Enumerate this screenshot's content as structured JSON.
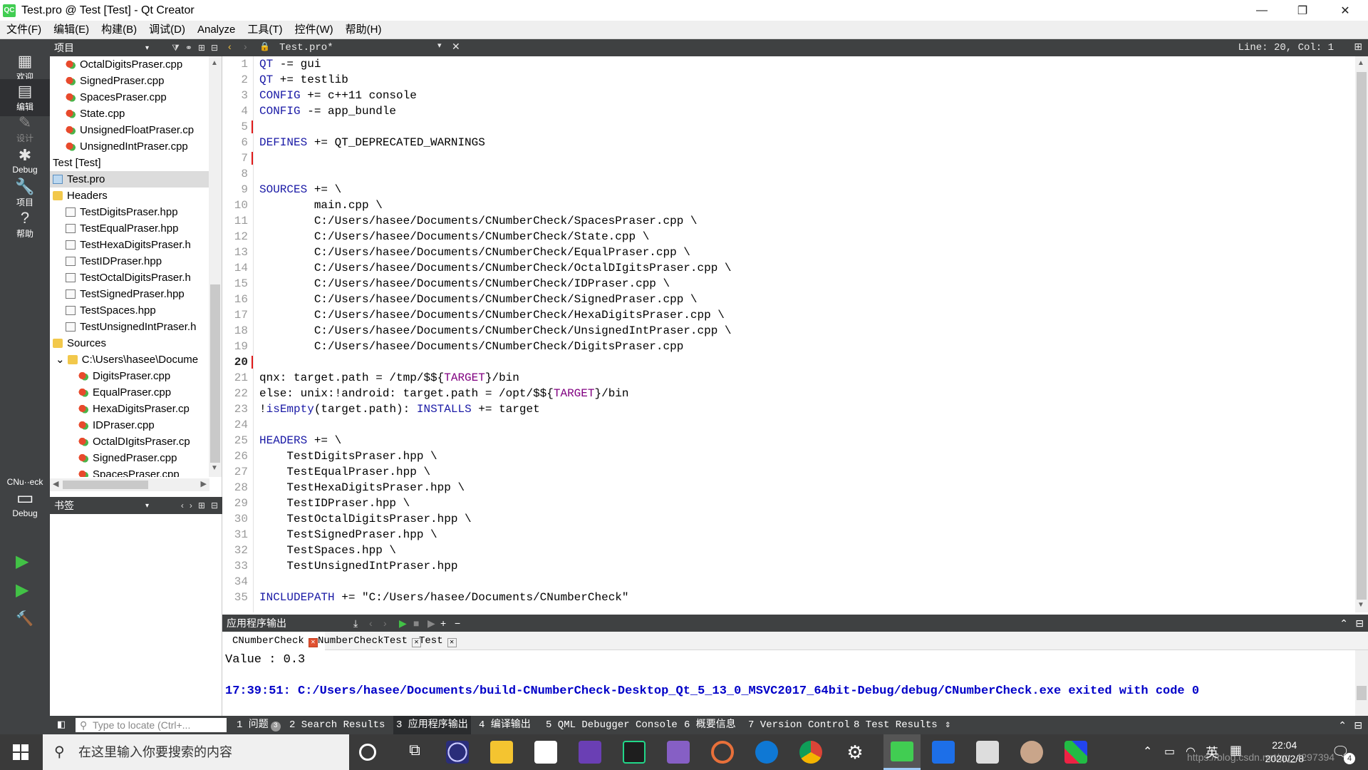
{
  "window": {
    "title": "Test.pro @ Test [Test] - Qt Creator",
    "app_icon": "QC"
  },
  "menu": [
    "文件(F)",
    "编辑(E)",
    "构建(B)",
    "调试(D)",
    "Analyze",
    "工具(T)",
    "控件(W)",
    "帮助(H)"
  ],
  "modes": [
    {
      "label": "欢迎",
      "icon": "grid-icon"
    },
    {
      "label": "编辑",
      "icon": "edit-icon",
      "active": true
    },
    {
      "label": "设计",
      "icon": "design-icon",
      "dim": true
    },
    {
      "label": "Debug",
      "icon": "bug-icon"
    },
    {
      "label": "项目",
      "icon": "wrench-icon"
    },
    {
      "label": "帮助",
      "icon": "help-icon"
    }
  ],
  "kit": {
    "project": "CNu··eck",
    "config": "Debug"
  },
  "project_panel": {
    "title": "项目",
    "tree": [
      {
        "indent": 1,
        "type": "cpp",
        "label": "OctalDigitsPraser.cpp"
      },
      {
        "indent": 1,
        "type": "cpp",
        "label": "SignedPraser.cpp"
      },
      {
        "indent": 1,
        "type": "cpp",
        "label": "SpacesPraser.cpp"
      },
      {
        "indent": 1,
        "type": "cpp",
        "label": "State.cpp"
      },
      {
        "indent": 1,
        "type": "cpp",
        "label": "UnsignedFloatPraser.cp"
      },
      {
        "indent": 1,
        "type": "cpp",
        "label": "UnsignedIntPraser.cpp"
      },
      {
        "indent": 0,
        "type": "none",
        "label": "Test [Test]"
      },
      {
        "indent": 0,
        "type": "pro",
        "label": "Test.pro",
        "selected": true
      },
      {
        "indent": 0,
        "type": "fold",
        "label": "Headers"
      },
      {
        "indent": 1,
        "type": "hpp",
        "label": "TestDigitsPraser.hpp"
      },
      {
        "indent": 1,
        "type": "hpp",
        "label": "TestEqualPraser.hpp"
      },
      {
        "indent": 1,
        "type": "hpp",
        "label": "TestHexaDigitsPraser.h"
      },
      {
        "indent": 1,
        "type": "hpp",
        "label": "TestIDPraser.hpp"
      },
      {
        "indent": 1,
        "type": "hpp",
        "label": "TestOctalDigitsPraser.h"
      },
      {
        "indent": 1,
        "type": "hpp",
        "label": "TestSignedPraser.hpp"
      },
      {
        "indent": 1,
        "type": "hpp",
        "label": "TestSpaces.hpp"
      },
      {
        "indent": 1,
        "type": "hpp",
        "label": "TestUnsignedIntPraser.h"
      },
      {
        "indent": 0,
        "type": "fold",
        "label": "Sources"
      },
      {
        "indent": 1,
        "type": "fold",
        "label": "C:\\Users\\hasee\\Docume",
        "expanded": true
      },
      {
        "indent": 2,
        "type": "cpp",
        "label": "DigitsPraser.cpp"
      },
      {
        "indent": 2,
        "type": "cpp",
        "label": "EqualPraser.cpp"
      },
      {
        "indent": 2,
        "type": "cpp",
        "label": "HexaDigitsPraser.cp"
      },
      {
        "indent": 2,
        "type": "cpp",
        "label": "IDPraser.cpp"
      },
      {
        "indent": 2,
        "type": "cpp",
        "label": "OctalDIgitsPraser.cp"
      },
      {
        "indent": 2,
        "type": "cpp",
        "label": "SignedPraser.cpp"
      },
      {
        "indent": 2,
        "type": "cpp",
        "label": "SpacesPraser.cpp"
      }
    ]
  },
  "bookmarks_panel": {
    "title": "书签"
  },
  "editor": {
    "file": "Test.pro*",
    "position": "Line: 20, Col: 1",
    "current_line": 20,
    "marked_lines": [
      5,
      7,
      20
    ],
    "lines": [
      "QT -= gui",
      "QT += testlib",
      "CONFIG += c++11 console",
      "CONFIG -= app_bundle",
      "",
      "DEFINES += QT_DEPRECATED_WARNINGS",
      "",
      "",
      "SOURCES += \\",
      "        main.cpp \\",
      "        C:/Users/hasee/Documents/CNumberCheck/SpacesPraser.cpp \\",
      "        C:/Users/hasee/Documents/CNumberCheck/State.cpp \\",
      "        C:/Users/hasee/Documents/CNumberCheck/EqualPraser.cpp \\",
      "        C:/Users/hasee/Documents/CNumberCheck/OctalDIgitsPraser.cpp \\",
      "        C:/Users/hasee/Documents/CNumberCheck/IDPraser.cpp \\",
      "        C:/Users/hasee/Documents/CNumberCheck/SignedPraser.cpp \\",
      "        C:/Users/hasee/Documents/CNumberCheck/HexaDigitsPraser.cpp \\",
      "        C:/Users/hasee/Documents/CNumberCheck/UnsignedIntPraser.cpp \\",
      "        C:/Users/hasee/Documents/CNumberCheck/DigitsPraser.cpp",
      "",
      "qnx: target.path = /tmp/$${TARGET}/bin",
      "else: unix:!android: target.path = /opt/$${TARGET}/bin",
      "!isEmpty(target.path): INSTALLS += target",
      "",
      "HEADERS += \\",
      "    TestDigitsPraser.hpp \\",
      "    TestEqualPraser.hpp \\",
      "    TestHexaDigitsPraser.hpp \\",
      "    TestIDPraser.hpp \\",
      "    TestOctalDigitsPraser.hpp \\",
      "    TestSignedPraser.hpp \\",
      "    TestSpaces.hpp \\",
      "    TestUnsignedIntPraser.hpp",
      "",
      "INCLUDEPATH += \"C:/Users/hasee/Documents/CNumberCheck\""
    ]
  },
  "output": {
    "title": "应用程序输出",
    "tabs": [
      {
        "label": "CNumberCheck",
        "active": true
      },
      {
        "label": "NumberCheckTest"
      },
      {
        "label": "Test"
      }
    ],
    "line1": "Value : 0.3",
    "line2": "17:39:51: C:/Users/hasee/Documents/build-CNumberCheck-Desktop_Qt_5_13_0_MSVC2017_64bit-Debug/debug/CNumberCheck.exe exited with code 0"
  },
  "statusbar": {
    "locator_placeholder": "Type to locate (Ctrl+...",
    "items": [
      "1 问题",
      "2 Search Results",
      "3 应用程序输出",
      "4 编译输出",
      "5 QML Debugger Console",
      "6 概要信息",
      "7 Version Control",
      "8 Test Results"
    ],
    "issues_badge": "3"
  },
  "taskbar": {
    "search_placeholder": "在这里输入你要搜索的内容",
    "ime": "英",
    "time": "22:04",
    "date": "2020/2/8",
    "notification_count": "4",
    "watermark": "https://blog.csdn.net/qq_4297394"
  }
}
